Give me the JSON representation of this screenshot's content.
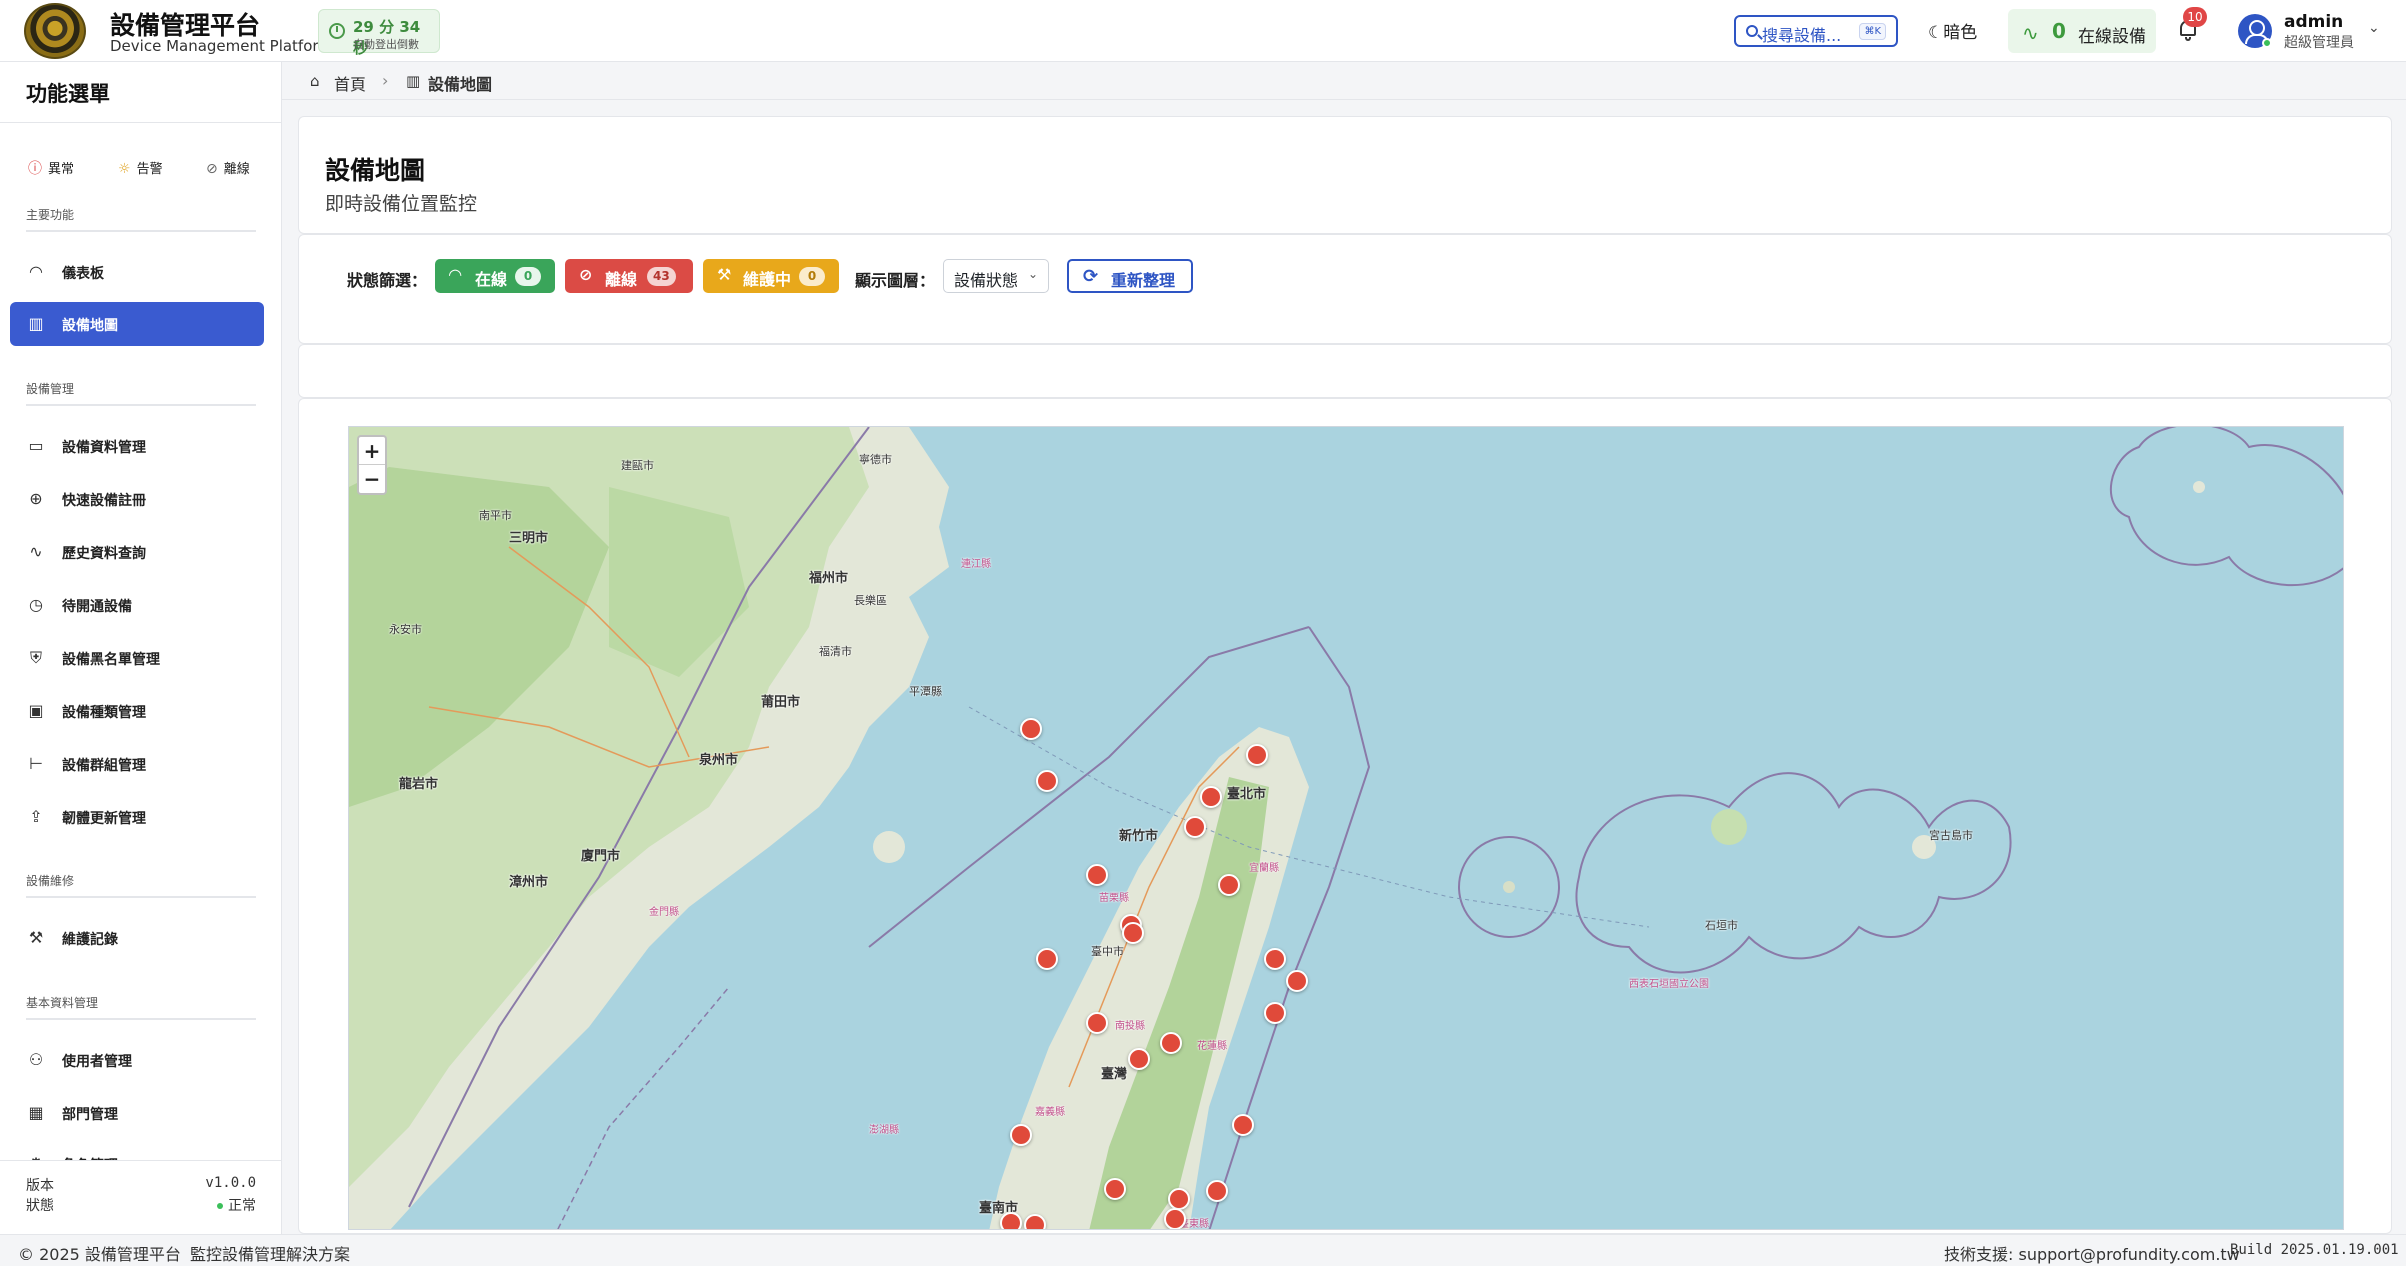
{
  "header": {
    "title": "設備管理平台",
    "subtitle": "Device Management Platform",
    "timer": {
      "value": "29 分 34 秒",
      "label": "自動登出倒數"
    },
    "search": {
      "label": "搜尋設備...",
      "shortcut": "⌘K"
    },
    "theme_toggle": "暗色",
    "online": {
      "count": "0",
      "label": "在線設備"
    },
    "notifications": "10",
    "user": {
      "name": "admin",
      "role": "超級管理員"
    }
  },
  "sidebar": {
    "title": "功能選單",
    "quick": [
      {
        "label": "異常",
        "icon": "alert-icon"
      },
      {
        "label": "告警",
        "icon": "bulb-icon"
      },
      {
        "label": "離線",
        "icon": "offline-icon"
      }
    ],
    "sections": [
      {
        "title": "主要功能",
        "items": [
          {
            "label": "儀表板",
            "icon": "gauge-icon",
            "active": false
          },
          {
            "label": "設備地圖",
            "icon": "map-icon",
            "active": true
          }
        ]
      },
      {
        "title": "設備管理",
        "items": [
          {
            "label": "設備資料管理",
            "icon": "monitor-icon"
          },
          {
            "label": "快速設備註冊",
            "icon": "plus-circle-icon"
          },
          {
            "label": "歷史資料查詢",
            "icon": "activity-icon"
          },
          {
            "label": "待開通設備",
            "icon": "clock-icon"
          },
          {
            "label": "設備黑名單管理",
            "icon": "shield-icon"
          },
          {
            "label": "設備種類管理",
            "icon": "chip-icon"
          },
          {
            "label": "設備群組管理",
            "icon": "tree-icon"
          },
          {
            "label": "韌體更新管理",
            "icon": "upload-icon"
          }
        ]
      },
      {
        "title": "設備維修",
        "items": [
          {
            "label": "維護記錄",
            "icon": "wrench-icon"
          }
        ]
      },
      {
        "title": "基本資料管理",
        "items": [
          {
            "label": "使用者管理",
            "icon": "users-icon"
          },
          {
            "label": "部門管理",
            "icon": "building-icon"
          },
          {
            "label": "角色管理",
            "icon": "role-icon"
          }
        ]
      }
    ],
    "version_label": "版本",
    "version": "v1.0.0",
    "status_label": "狀態",
    "status": "正常"
  },
  "breadcrumb": {
    "home": "首頁",
    "current": "設備地圖"
  },
  "page": {
    "title": "設備地圖",
    "subtitle": "即時設備位置監控"
  },
  "filters": {
    "label": "狀態篩選：",
    "chips": [
      {
        "label": "在線",
        "count": "0",
        "color": "#3aa55a",
        "icon": "wifi-icon"
      },
      {
        "label": "離線",
        "count": "43",
        "color": "#db4b45",
        "icon": "wifi-off-icon"
      },
      {
        "label": "維護中",
        "count": "0",
        "color": "#e8a81b",
        "icon": "wrench-icon"
      }
    ],
    "layer_label": "顯示圖層：",
    "layer_value": "設備狀態",
    "refresh": "重新整理"
  },
  "map": {
    "zoom_in": "+",
    "zoom_out": "−",
    "labels": [
      "建甌市",
      "寧德市",
      "南平市",
      "三明市",
      "福州市",
      "長樂區",
      "福清市",
      "平潭縣",
      "莆田市",
      "泉州市",
      "廈門市",
      "漳州市",
      "龍岩市",
      "永安市",
      "連江縣",
      "金門縣",
      "臺北市",
      "新竹市",
      "宜蘭縣",
      "苗栗縣",
      "臺中市",
      "南投縣",
      "花蓮縣",
      "臺灣",
      "嘉義縣",
      "臺南市",
      "臺東縣",
      "宮古島市",
      "石垣市",
      "澎湖縣",
      "西表石垣國立公園"
    ],
    "marker_count": 43
  },
  "footer": {
    "copyright": "© 2025 設備管理平台",
    "slogan": "監控設備管理解決方案",
    "support": "技術支援: support@profundity.com.tw",
    "build": "Build 2025.01.19.001"
  }
}
